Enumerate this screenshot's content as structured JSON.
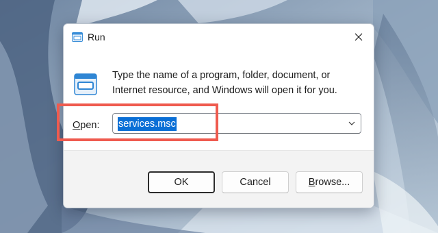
{
  "window": {
    "title": "Run",
    "close_glyph": "close-icon"
  },
  "description": {
    "line1": "Type the name of a program, folder, document, or",
    "line2": "Internet resource, and Windows will open it for you."
  },
  "open_field": {
    "label_mnemonic": "O",
    "label_rest": "pen:",
    "value": "services.msc",
    "selected": true,
    "icon": "chevron-down-icon"
  },
  "buttons": {
    "ok": "OK",
    "cancel": "Cancel",
    "browse_mnemonic": "B",
    "browse_rest": "rowse..."
  },
  "icons": {
    "title": "run-app-icon",
    "main": "run-app-icon"
  },
  "colors": {
    "highlight": "#ef5b4f",
    "selection": "#0a6fd6",
    "desktop": "#7d93ad"
  }
}
